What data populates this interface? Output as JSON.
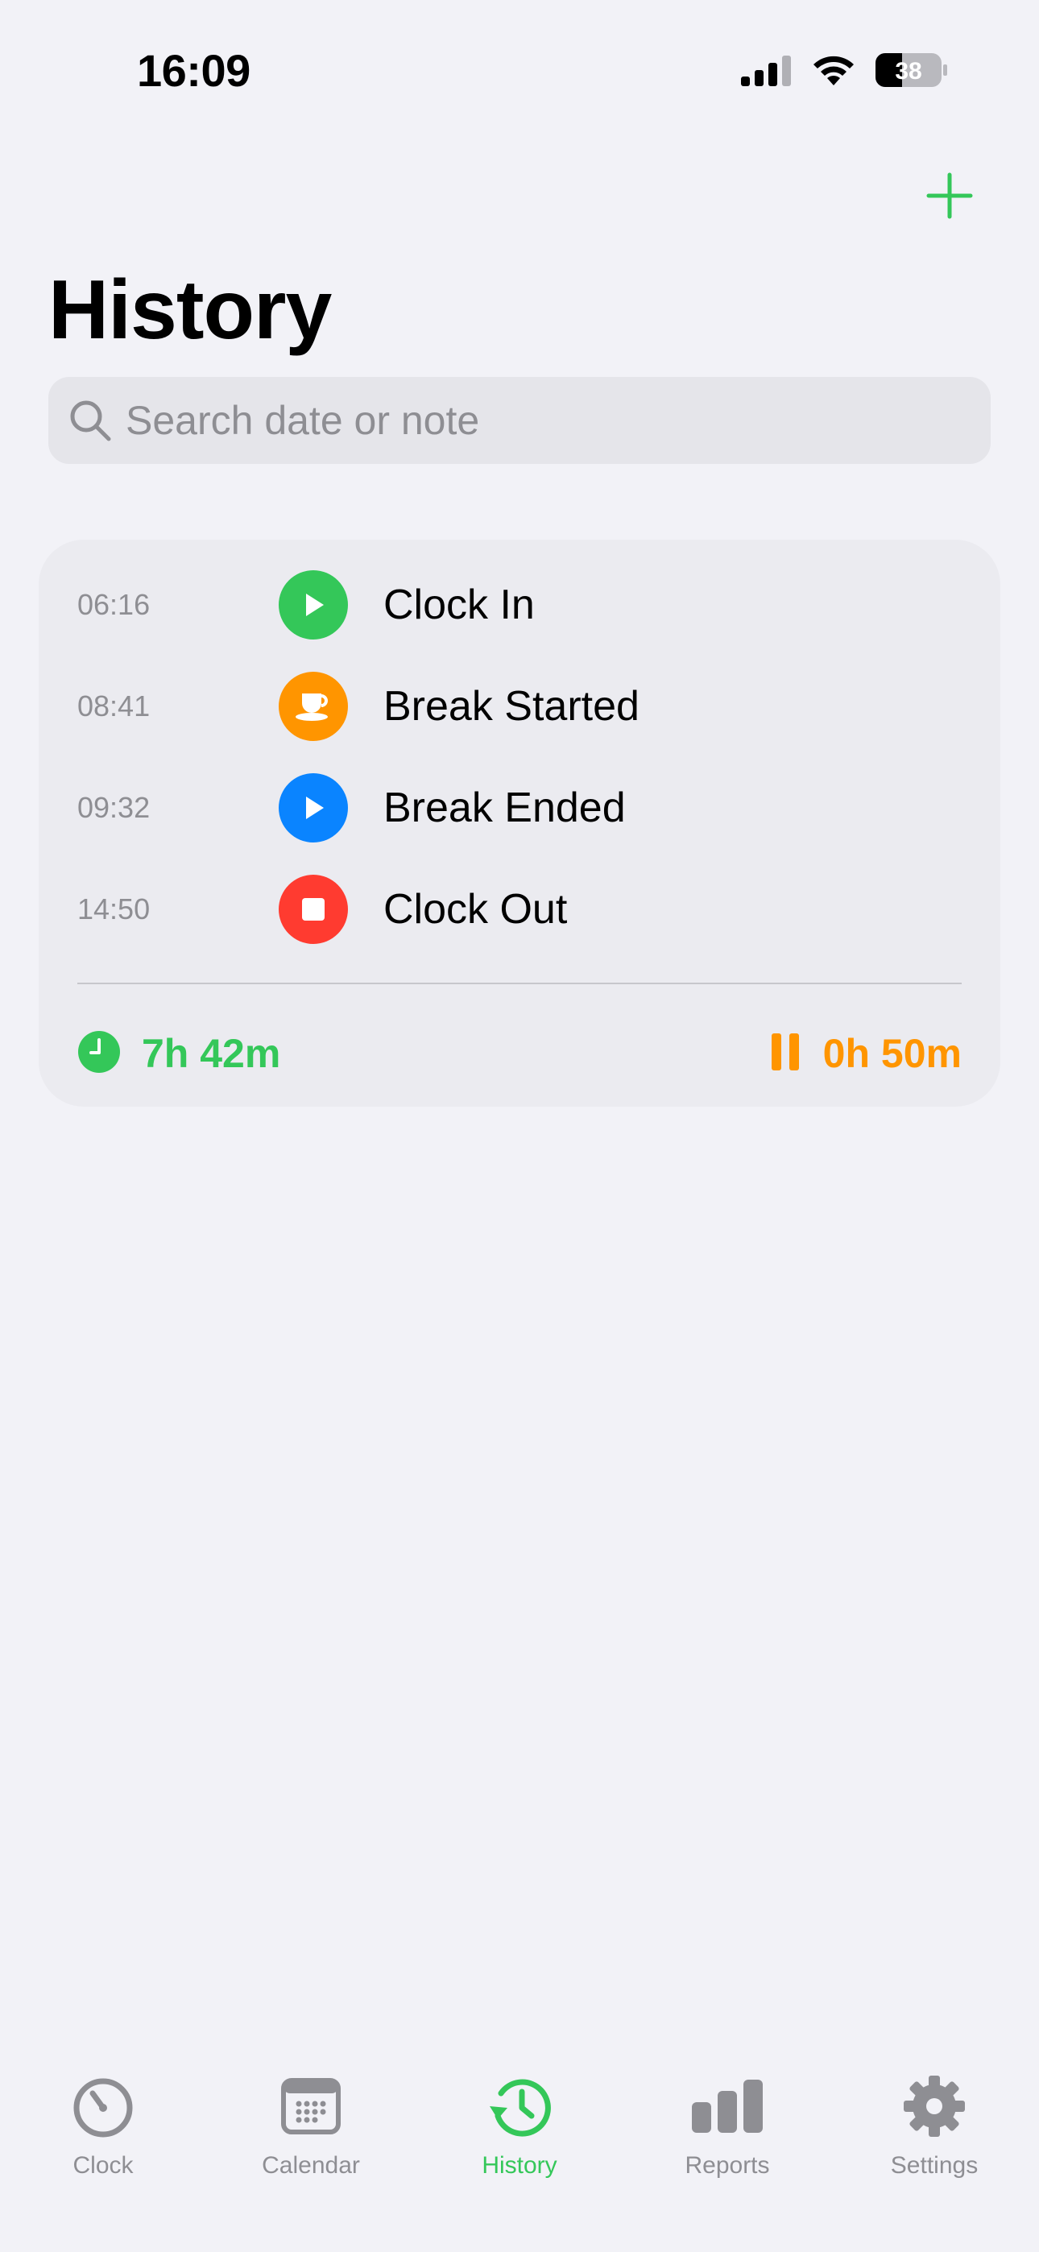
{
  "status_bar": {
    "time": "16:09",
    "battery": "38"
  },
  "nav": {
    "add_icon": "plus-icon",
    "title": "History"
  },
  "search": {
    "placeholder": "Search date or note",
    "value": ""
  },
  "day_card": {
    "entries": [
      {
        "time": "06:16",
        "label": "Clock In",
        "icon": "play-icon",
        "color": "#34c759"
      },
      {
        "time": "08:41",
        "label": "Break Started",
        "icon": "coffee-cup-icon",
        "color": "#ff9500"
      },
      {
        "time": "09:32",
        "label": "Break Ended",
        "icon": "play-icon",
        "color": "#0a84ff"
      },
      {
        "time": "14:50",
        "label": "Clock Out",
        "icon": "stop-icon",
        "color": "#ff3b30"
      }
    ],
    "total_worked": "7h 42m",
    "total_break": "0h 50m"
  },
  "tab_bar": {
    "items": [
      {
        "label": "Clock",
        "icon": "timer-icon",
        "active": false
      },
      {
        "label": "Calendar",
        "icon": "calendar-icon",
        "active": false
      },
      {
        "label": "History",
        "icon": "history-icon",
        "active": true
      },
      {
        "label": "Reports",
        "icon": "bar-chart-icon",
        "active": false
      },
      {
        "label": "Settings",
        "icon": "gear-icon",
        "active": false
      }
    ]
  },
  "colors": {
    "accent": "#34c759",
    "break": "#ff9500",
    "resume": "#0a84ff",
    "stop": "#ff3b30",
    "inactive": "#8e8e93",
    "background": "#f2f2f7"
  }
}
